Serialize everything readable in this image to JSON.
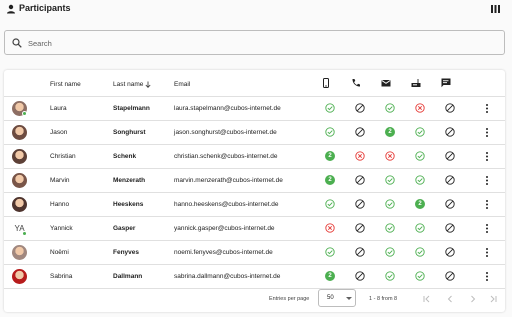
{
  "header": {
    "title": "Participants"
  },
  "search": {
    "placeholder": "Search"
  },
  "table": {
    "columns": {
      "first_name": "First name",
      "last_name": "Last name",
      "email": "Email"
    },
    "channel_icons": [
      "phone-app-icon",
      "phone-call-icon",
      "email-icon",
      "fax-icon",
      "sms-icon"
    ],
    "rows": [
      {
        "avatar": "avatar-laura",
        "online": true,
        "first": "Laura",
        "last": "Stapelmann",
        "email": "laura.stapelmann@cubos-internet.de",
        "status": [
          "check",
          "blocked",
          "check",
          "cross",
          "blocked"
        ]
      },
      {
        "avatar": "avatar-jason",
        "online": false,
        "first": "Jason",
        "last": "Songhurst",
        "email": "jason.songhurst@cubos-internet.de",
        "status": [
          "check",
          "blocked",
          "2",
          "check",
          "blocked"
        ]
      },
      {
        "avatar": "avatar-christian",
        "online": false,
        "first": "Christian",
        "last": "Schenk",
        "email": "christian.schenk@cubos-internet.de",
        "status": [
          "2",
          "cross",
          "cross",
          "check",
          "blocked"
        ]
      },
      {
        "avatar": "avatar-marvin",
        "online": false,
        "first": "Marvin",
        "last": "Menzerath",
        "email": "marvin.menzerath@cubos-internet.de",
        "status": [
          "2",
          "blocked",
          "check",
          "check",
          "blocked"
        ]
      },
      {
        "avatar": "avatar-hanno",
        "online": false,
        "first": "Hanno",
        "last": "Heeskens",
        "email": "hanno.heeskens@cubos-internet.de",
        "status": [
          "check",
          "blocked",
          "check",
          "2",
          "blocked"
        ]
      },
      {
        "avatar": "avatar-yannick",
        "initials": "YA",
        "online": true,
        "first": "Yannick",
        "last": "Gasper",
        "email": "yannick.gasper@cubos-internet.de",
        "status": [
          "cross",
          "blocked",
          "check",
          "check",
          "blocked"
        ]
      },
      {
        "avatar": "avatar-noemi",
        "online": false,
        "first": "Noëmi",
        "last": "Fenyves",
        "email": "noemi.fenyves@cubos-internet.de",
        "status": [
          "check",
          "blocked",
          "check",
          "check",
          "blocked"
        ]
      },
      {
        "avatar": "avatar-sabrina",
        "online": false,
        "first": "Sabrina",
        "last": "Dallmann",
        "email": "sabrina.dallmann@cubos-internet.de",
        "status": [
          "2",
          "blocked",
          "check",
          "check",
          "blocked"
        ]
      }
    ]
  },
  "footer": {
    "entries_label": "Entries per page",
    "entries_value": "50",
    "range": "1 - 8 from 8"
  },
  "colors": {
    "check": "#4caf50",
    "cross": "#e53935",
    "blocked": "#212121",
    "disabled": "#bdbdbd"
  }
}
